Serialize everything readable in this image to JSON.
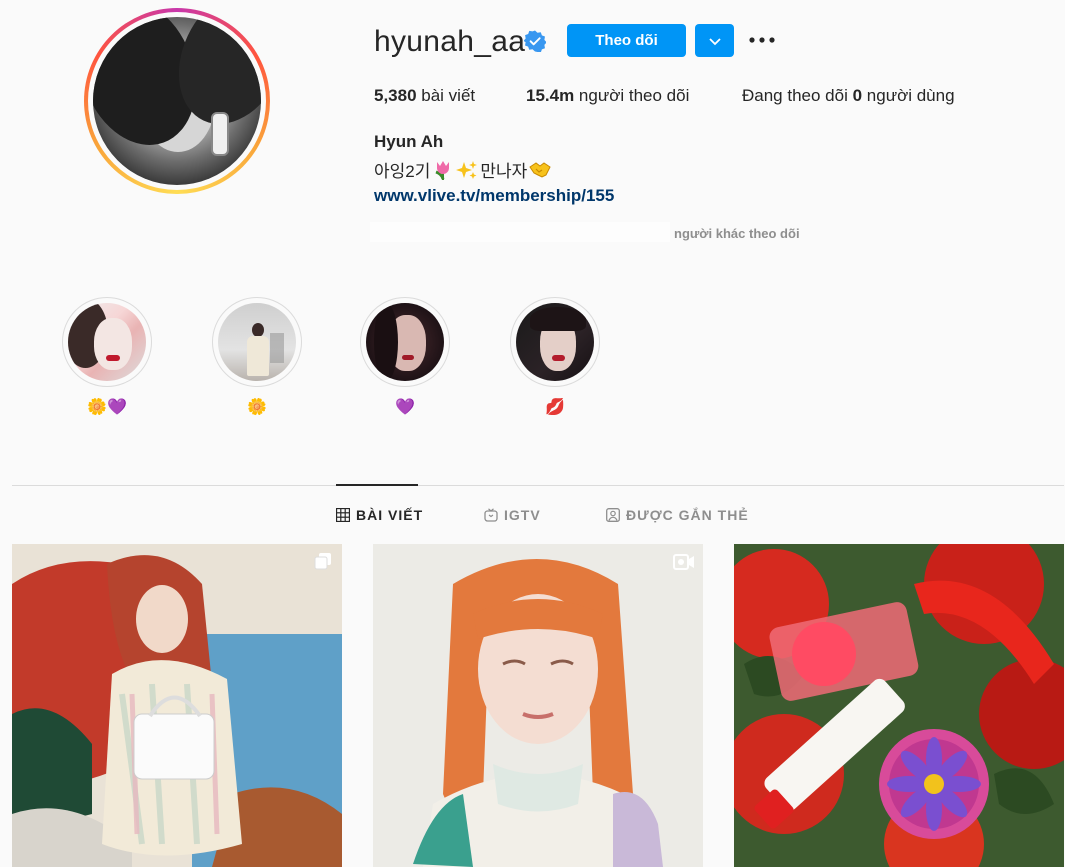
{
  "profile": {
    "username": "hyunah_aa",
    "follow_label": "Theo dõi",
    "full_name": "Hyun Ah",
    "bio_text_1": "아잉2기",
    "bio_text_2": "만나자",
    "link": "www.vlive.tv/membership/155",
    "followed_by": "người khác theo dõi"
  },
  "stats": {
    "posts_value": "5,380",
    "posts_label": " bài viết",
    "followers_value": "15.4m",
    "followers_label": " người theo dõi",
    "following_prefix": "Đang theo dõi ",
    "following_value": "0",
    "following_label": " người dùng"
  },
  "highlights": [
    {
      "label": "🌼💜"
    },
    {
      "label": "🌼"
    },
    {
      "label": "💜"
    },
    {
      "label": "💋"
    }
  ],
  "tabs": {
    "posts": "BÀI VIẾT",
    "igtv": "IGTV",
    "tagged": "ĐƯỢC GẮN THẺ"
  },
  "colors": {
    "accent": "#0095f6",
    "link": "#00376b",
    "muted": "#8e8e8e"
  }
}
